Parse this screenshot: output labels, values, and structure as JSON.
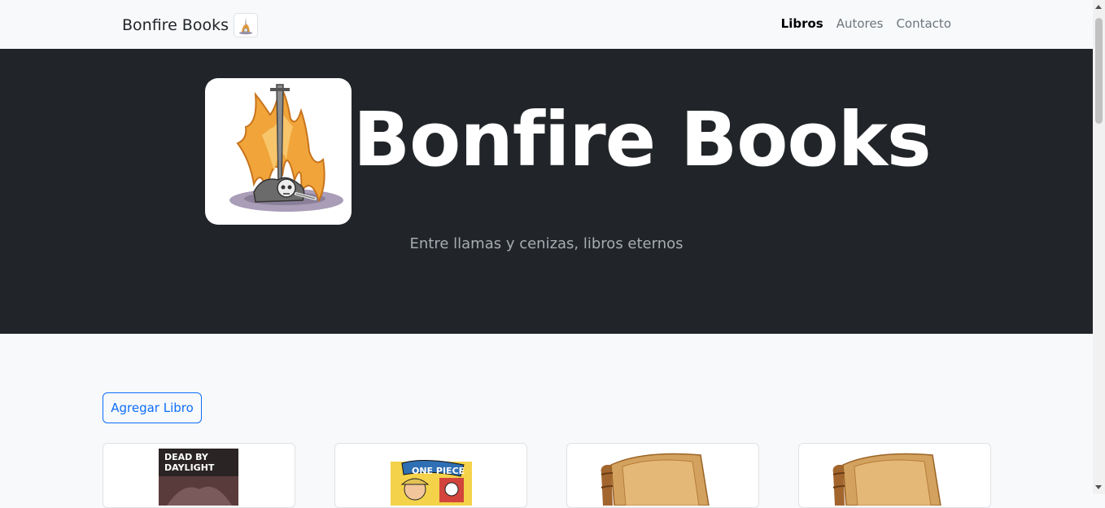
{
  "navbar": {
    "brand": "Bonfire Books",
    "links": [
      {
        "label": "Libros",
        "active": true
      },
      {
        "label": "Autores",
        "active": false
      },
      {
        "label": "Contacto",
        "active": false
      }
    ]
  },
  "hero": {
    "title": "Bonfire Books",
    "subtitle": "Entre llamas y cenizas, libros eternos"
  },
  "actions": {
    "add_book_label": "Agregar Libro"
  },
  "books": [
    {
      "cover": "dead-by-daylight-cover-image",
      "cover_text": "DEAD BY DAYLIGHT"
    },
    {
      "cover": "one-piece-cover-image",
      "cover_text": "ONE PIECE"
    },
    {
      "cover": "placeholder-book-image"
    },
    {
      "cover": "placeholder-book-image"
    }
  ],
  "colors": {
    "hero_bg": "#212529",
    "page_bg": "#f8f9fa",
    "accent": "#0d6efd"
  }
}
